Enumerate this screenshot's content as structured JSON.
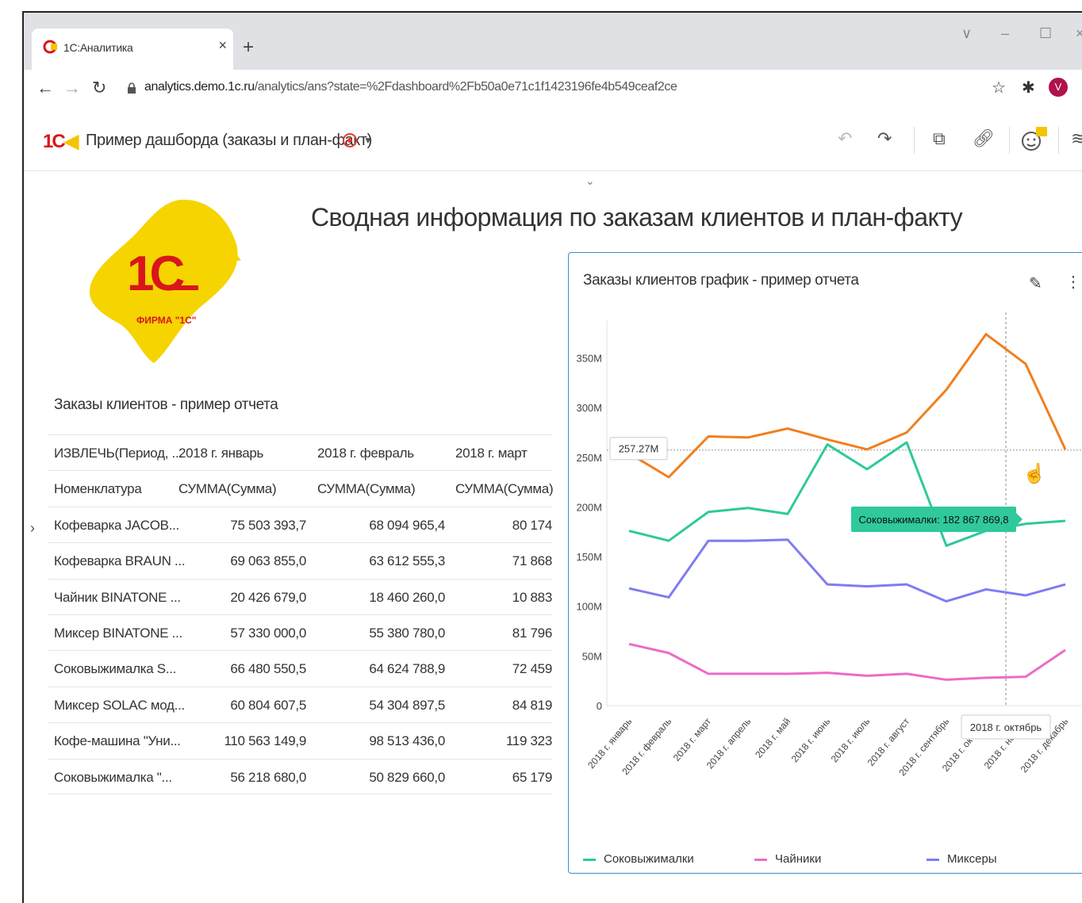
{
  "browser": {
    "tab_title": "1С:Аналитика",
    "tab_close": "×",
    "new_tab": "+",
    "url_host": "analytics.demo.1c.ru",
    "url_path": "/analytics/ans?state=%2Fdashboard%2Fb50a0e71c1f1423196fe4b549ceaf2ce",
    "avatar_letter": "V"
  },
  "header": {
    "logo_text": "1С",
    "dashboard_title": "Пример дашборда (заказы и план-факт)"
  },
  "main": {
    "title": "Сводная информация по заказам клиентов и план-факту",
    "logo_caption": "ФИРМА \"1С\""
  },
  "table": {
    "title": "Заказы клиентов - пример отчета",
    "header1": [
      "ИЗВЛЕЧЬ(Период, ...",
      "2018 г. январь",
      "2018 г. февраль",
      "2018 г. март"
    ],
    "header2": [
      "Номенклатура",
      "СУММА(Сумма)",
      "СУММА(Сумма)",
      "СУММА(Сумма)"
    ],
    "rows": [
      [
        "Кофеварка JACOB...",
        "75 503 393,7",
        "68 094 965,4",
        "80 174"
      ],
      [
        "Кофеварка BRAUN ...",
        "69 063 855,0",
        "63 612 555,3",
        "71 868"
      ],
      [
        "Чайник BINATONE  ...",
        "20 426 679,0",
        "18 460 260,0",
        "10 883"
      ],
      [
        "Миксер BINATONE ...",
        "57 330 000,0",
        "55 380 780,0",
        "81 796"
      ],
      [
        "Соковыжималка  S...",
        "66 480 550,5",
        "64 624 788,9",
        "72 459"
      ],
      [
        "Миксер SOLAC мод...",
        "60 804 607,5",
        "54 304 897,5",
        "84 819"
      ],
      [
        "Кофе-машина \"Уни...",
        "110 563 149,9",
        "98 513 436,0",
        "119 323"
      ],
      [
        "Соковыжималка \"...",
        "56 218 680,0",
        "50 829 660,0",
        "65 179"
      ]
    ]
  },
  "chart_card": {
    "title": "Заказы клиентов график - пример отчета",
    "crosshair_y_label": "257.27M",
    "crosshair_x_label": "2018 г. октябрь",
    "tooltip": "Соковыжималки: 182 867 869,8"
  },
  "chart_data": {
    "type": "line",
    "categories": [
      "2018 г. январь",
      "2018 г. февраль",
      "2018 г. март",
      "2018 г. апрель",
      "2018 г. май",
      "2018 г. июнь",
      "2018 г. июль",
      "2018 г. август",
      "2018 г. сентябрь",
      "2018 г. октябрь",
      "2018 г. ноябрь",
      "2018 г. декабрь"
    ],
    "y_ticks": [
      "0",
      "50M",
      "100M",
      "150M",
      "200M",
      "250M",
      "300M",
      "350M"
    ],
    "ylim": [
      0,
      380
    ],
    "series": [
      {
        "name": "",
        "color": "#f07f1e",
        "values": [
          254,
          230,
          271,
          270,
          279,
          268,
          258,
          275,
          318,
          374,
          344,
          258
        ]
      },
      {
        "name": "Соковыжималки",
        "color": "#2fc99b",
        "values": [
          176,
          166,
          195,
          199,
          193,
          263,
          238,
          265,
          161,
          176,
          183,
          186
        ]
      },
      {
        "name": "Чайники",
        "color": "#ec6cc6",
        "values": [
          62,
          53,
          32,
          32,
          32,
          33,
          30,
          32,
          26,
          28,
          29,
          56
        ]
      },
      {
        "name": "Миксеры",
        "color": "#7f7cf2",
        "values": [
          118,
          109,
          166,
          166,
          167,
          122,
          120,
          122,
          105,
          117,
          111,
          122
        ]
      }
    ],
    "crosshair_value": 257.27,
    "crosshair_index": 9,
    "legend": [
      "Соковыжималки",
      "Чайники",
      "Миксеры"
    ],
    "legend_placement": "bottom"
  }
}
